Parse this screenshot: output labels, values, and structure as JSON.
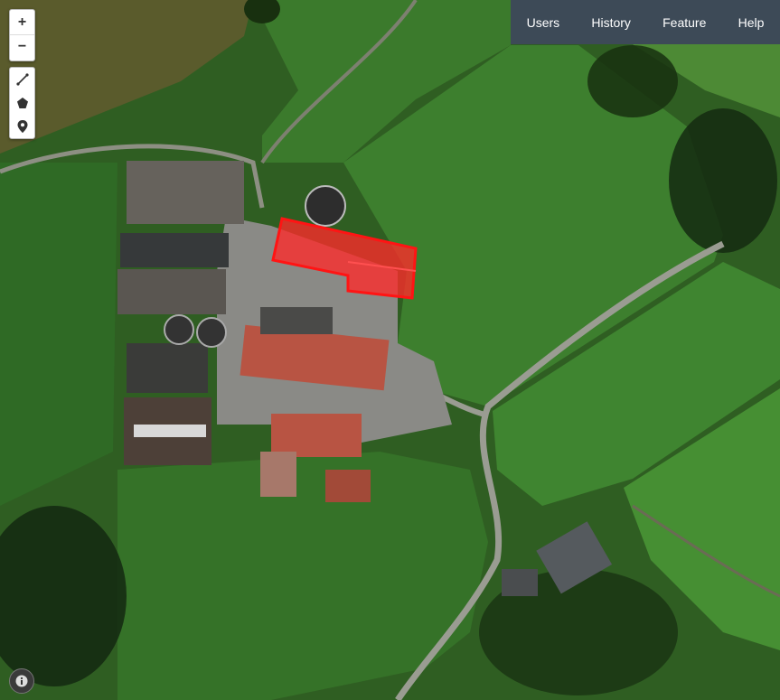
{
  "map": {
    "type": "satellite",
    "selection_color": "#ff2020"
  },
  "zoom_controls": {
    "zoom_in_label": "+",
    "zoom_out_label": "−"
  },
  "draw_tools": [
    "line-tool-icon",
    "polygon-tool-icon",
    "marker-tool-icon"
  ],
  "nav": {
    "items": [
      {
        "label": "Users"
      },
      {
        "label": "History"
      },
      {
        "label": "Feature"
      },
      {
        "label": "Help"
      }
    ]
  },
  "info_icon": "info-icon"
}
